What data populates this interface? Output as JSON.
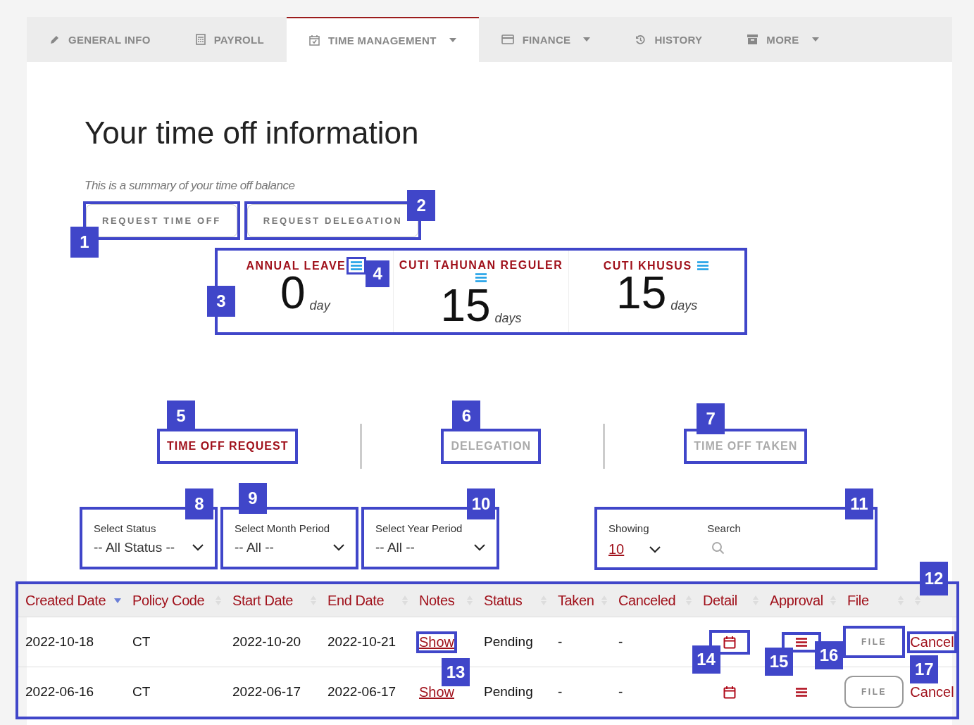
{
  "nav_tabs": [
    {
      "label": "GENERAL INFO",
      "dropdown": false,
      "selected": false
    },
    {
      "label": "PAYROLL",
      "dropdown": false,
      "selected": false
    },
    {
      "label": "TIME MANAGEMENT",
      "dropdown": true,
      "selected": true
    },
    {
      "label": "FINANCE",
      "dropdown": true,
      "selected": false
    },
    {
      "label": "HISTORY",
      "dropdown": false,
      "selected": false
    },
    {
      "label": "MORE",
      "dropdown": true,
      "selected": false
    }
  ],
  "title": "Your time off information",
  "subtitle": "This is a summary of your time off balance",
  "actions": [
    {
      "label": "REQUEST TIME OFF",
      "callout": "1"
    },
    {
      "label": "REQUEST DELEGATION",
      "callout": "2"
    }
  ],
  "balances": {
    "callout": "3",
    "items": [
      {
        "title": "ANNUAL LEAVE",
        "value": "0",
        "unit": "day",
        "callout": "4"
      },
      {
        "title": "CUTI TAHUNAN REGULER",
        "value": "15",
        "unit": "days"
      },
      {
        "title": "CUTI KHUSUS",
        "value": "15",
        "unit": "days"
      }
    ]
  },
  "section_tabs": [
    {
      "label": "TIME OFF REQUEST",
      "selected": true,
      "callout": "5"
    },
    {
      "label": "DELEGATION",
      "selected": false,
      "callout": "6"
    },
    {
      "label": "TIME OFF TAKEN",
      "selected": false,
      "callout": "7"
    }
  ],
  "filters": [
    {
      "label": "Select Status",
      "value": "-- All Status --",
      "callout": "8"
    },
    {
      "label": "Select Month Period",
      "value": "-- All --",
      "callout": "9"
    },
    {
      "label": "Select Year Period",
      "value": "-- All --",
      "callout": "10"
    }
  ],
  "list_controls": {
    "callout": "11",
    "showing_label": "Showing",
    "showing_value": "10",
    "search_label": "Search"
  },
  "table": {
    "callout": "12",
    "columns": [
      {
        "label": "Created Date",
        "sorted": true
      },
      {
        "label": "Policy Code",
        "sorted": false
      },
      {
        "label": "Start Date",
        "sorted": false
      },
      {
        "label": "End Date",
        "sorted": false
      },
      {
        "label": "Notes",
        "sorted": false
      },
      {
        "label": "Status",
        "sorted": false
      },
      {
        "label": "Taken",
        "sorted": false
      },
      {
        "label": "Canceled",
        "sorted": false
      },
      {
        "label": "Detail",
        "sorted": false
      },
      {
        "label": "Approval",
        "sorted": false
      },
      {
        "label": "File",
        "sorted": false
      },
      {
        "sorted": false
      }
    ],
    "rows": [
      {
        "created": "2022-10-18",
        "policy": "CT",
        "start": "2022-10-20",
        "end": "2022-10-21",
        "notes": "Show",
        "status": "Pending",
        "taken": "-",
        "canceled": "-",
        "file": "FILE",
        "action": "Cancel",
        "callouts": {
          "notes": "13",
          "detail": "14",
          "approval": "15",
          "file": "16",
          "action": "17"
        }
      },
      {
        "created": "2022-06-16",
        "policy": "CT",
        "start": "2022-06-17",
        "end": "2022-06-17",
        "notes": "Show",
        "status": "Pending",
        "taken": "-",
        "canceled": "-",
        "file": "FILE",
        "action": "Cancel"
      }
    ]
  }
}
